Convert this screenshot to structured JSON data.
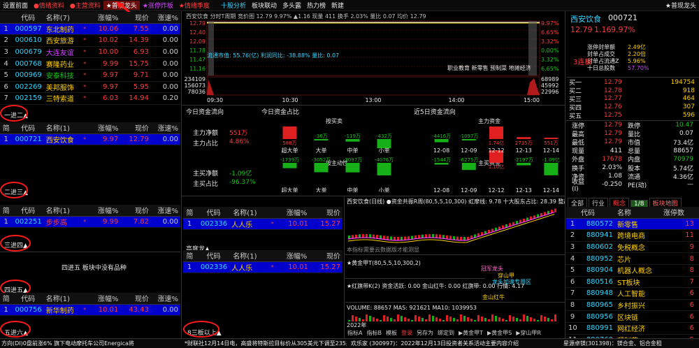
{
  "colors": {
    "bg": "#000000",
    "red": "#ff3b3b",
    "green": "#18c518",
    "cyan": "#33d6ff",
    "yellow": "#ffd200",
    "selected": "#0000cc"
  },
  "topbar": {
    "left": [
      "设置前面",
      "●情绪资料",
      "●主营资料",
      "★普现龙头",
      "★涨停炸板",
      "★情绪季度"
    ],
    "chart_tabs": [
      "十股分析",
      "板块联动",
      "多头露",
      "热力榜",
      "新建"
    ],
    "right": "★普现龙头"
  },
  "left_tables": {
    "top": {
      "headers": [
        "",
        "代码",
        "名称(7)",
        "涨幅%",
        "现价",
        "涨速%"
      ],
      "rows": [
        {
          "idx": "1",
          "code": "000597",
          "name": "东北制药",
          "pct": "10.06",
          "price": "7.55",
          "spd": "0.00",
          "sel": true,
          "name_color": "#ffd200"
        },
        {
          "idx": "2",
          "code": "000610",
          "name": "西安旅游",
          "pct": "10.02",
          "price": "14.39",
          "spd": "0.00",
          "name_color": "#ffd200"
        },
        {
          "idx": "3",
          "code": "000679",
          "name": "大连友谊",
          "pct": "10.00",
          "price": "6.93",
          "spd": "0.00",
          "name_color": "#d040ff"
        },
        {
          "idx": "4",
          "code": "000768",
          "name": "赛隆药业",
          "pct": "9.99",
          "price": "15.75",
          "spd": "0.00",
          "name_color": "#ffd200"
        },
        {
          "idx": "5",
          "code": "000969",
          "name": "安泰科技",
          "pct": "9.97",
          "price": "9.71",
          "spd": "0.00",
          "name_color": "#18c518"
        },
        {
          "idx": "6",
          "code": "002269",
          "name": "美邦服饰",
          "pct": "9.97",
          "price": "5.95",
          "spd": "0.00",
          "name_color": "#ffd200"
        },
        {
          "idx": "7",
          "code": "002159",
          "name": "三特索道",
          "pct": "6.03",
          "price": "14.94",
          "spd": "0.20",
          "name_color": "#ffd200"
        }
      ],
      "footer": "一进二▲"
    },
    "second": {
      "headers": [
        "简",
        "代码",
        "名称(1)",
        "涨幅%",
        "现价",
        "涨速%"
      ],
      "rows": [
        {
          "idx": "1",
          "code": "000721",
          "name": "西安饮食",
          "pct": "9.97",
          "price": "12.79",
          "spd": "0.00",
          "sel": true,
          "name_color": "#ffd200"
        }
      ],
      "footer": "二进三▲"
    },
    "third": {
      "headers": [
        "简",
        "代码",
        "名称(1)",
        "涨幅%",
        "现价",
        "涨速%"
      ],
      "rows": [
        {
          "idx": "1",
          "code": "002251",
          "name": "步步高",
          "pct": "9.99",
          "price": "7.82",
          "spd": "0.00",
          "sel": true,
          "name_color": "#ff3b3b"
        }
      ],
      "footer": "三进四▲"
    },
    "fourth": {
      "empty_msg": "四进五 板块中没有品种",
      "footer": "四进五▲"
    },
    "fifth": {
      "headers": [
        "简",
        "代码",
        "名称(1)",
        "涨幅%",
        "现价",
        "涨速%"
      ],
      "rows": [
        {
          "idx": "1",
          "code": "000756",
          "name": "新华制药",
          "pct": "10.01",
          "price": "43.43",
          "spd": "0.00",
          "sel": true,
          "name_color": "#ffd200"
        }
      ],
      "footer": "五进六▲"
    }
  },
  "mid_tables": {
    "high": {
      "headers": [
        "简",
        "代码",
        "名称(1)",
        "涨幅%",
        "现价"
      ],
      "rows": [
        {
          "idx": "1",
          "code": "002336",
          "name": "人人乐",
          "pct": "10.01",
          "price": "15.27",
          "sel": true,
          "name_color": "#ffd200"
        }
      ],
      "footer": "高度龙▲"
    },
    "eight": {
      "headers": [
        "简",
        "代码",
        "名称(1)",
        "涨幅%",
        "现价"
      ],
      "rows": [
        {
          "idx": "1",
          "code": "002336",
          "name": "人人乐",
          "pct": "10.01",
          "price": "15.27",
          "sel": true,
          "name_color": "#ffd200"
        }
      ],
      "footer": "8三板以上▲"
    }
  },
  "intraday": {
    "header": "西安饮食  分时T周期  竞价图  12.79  9.97%  ▲1.16  现量 411  换手 2.03%  量比 0.07  均价 12.79",
    "y_left": [
      "12.79",
      "12.40",
      "12.09",
      "11.78",
      "11.47",
      "11.16"
    ],
    "y_right": [
      "9.97%",
      "6.65%",
      "3.32%",
      "0.00%",
      "3.32%",
      "6.65%"
    ],
    "vol_left": [
      "234109",
      "156073",
      "78036"
    ],
    "vol_right": [
      "68989",
      "45992",
      "22996"
    ],
    "x_labels": [
      "09:30",
      "10:30",
      "13:00",
      "14:00",
      "15:00"
    ],
    "overlay_info": "流通市值: 55.76(亿)  利润同比: -38.88%  量比: 0.07",
    "tags": "职业教育  新零售  预制菜  地摊经济"
  },
  "fund": {
    "title_today": "今日资金流向",
    "title_share": "今日资金占比",
    "title_5day": "近5日资金流向",
    "main_net_label": "主力净额",
    "main_net": "551万",
    "main_ratio_label": "主力占比",
    "main_ratio": "4.86%",
    "buy_net_label": "主买净额",
    "buy_net": "-1.09亿",
    "buy_ratio_label": "主买占比",
    "buy_ratio": "-96.37%",
    "buysell_title": "按买卖",
    "active_title": "按主动性",
    "cats": [
      "超大单",
      "大单",
      "中单",
      "小单"
    ],
    "share_top_vals": [
      "588万",
      "-36万",
      "-119万",
      "-432万"
    ],
    "share_bot_vals": [
      "-1739万",
      "-3052万",
      "-3097万",
      "-4076万"
    ],
    "main_fund_title": "主力资金",
    "main_buy_title": "主买资金",
    "dates": [
      "12-08",
      "12-09",
      "12-12",
      "12-13",
      "12-14"
    ],
    "five_top_vals": [
      "-4416万",
      "-1097万",
      "1.74亿",
      "2735万",
      "551万"
    ],
    "five_bot_vals": [
      "-1544万",
      "-6275万",
      "1.10亿",
      "-2197万",
      "-1.09亿"
    ]
  },
  "kline": {
    "header": "西安饮食(日线) ●资金共振R周(80,5,5,10,300)  虹摩线: 9.78  十大股东占比: 28.39  整超",
    "note": "本指标需要云数据版才能测显",
    "ind1": "★黄金甲T(80,5,5,10,300,2)",
    "ind2": "★红旗带K(2)  资金活跃: 0.00  金山红牛: 0.00  红旗带: 0.00  行情: 4.17",
    "ind3": "VOLUME: 88657  MAS: 921621  MA10: 1039953",
    "marker1": "冠军龙头",
    "marker2": "穿山甲",
    "marker3": "龙头加速专用区",
    "marker4": "金山红牛",
    "year_label": "2022年",
    "bottom_tabs": [
      "指标A",
      "指标B",
      "模板",
      "登录",
      "另存为",
      "绑定到",
      "▶黄金甲T",
      "▶黄金甲S",
      "▶穿山甲R"
    ]
  },
  "quote": {
    "name": "西安饮食",
    "code": "000721",
    "price": "12.79",
    "chg": "1.16",
    "pct": "9.97%",
    "sub_rows": [
      {
        "k": "涨停封单额",
        "v": "2.49亿"
      },
      {
        "k": "封单占成交",
        "v": "2.20倍"
      },
      {
        "k": "封单占流通Z",
        "v": "5.96%"
      },
      {
        "k": "十日总股数",
        "v": "57.70%"
      }
    ],
    "board_tag": "3连板",
    "asks": [
      {
        "k": "买一",
        "p": "12.79",
        "v": "194754"
      },
      {
        "k": "买二",
        "p": "12.78",
        "v": "918"
      },
      {
        "k": "买三",
        "p": "12.77",
        "v": "464"
      },
      {
        "k": "买四",
        "p": "12.76",
        "v": "307"
      },
      {
        "k": "买五",
        "p": "12.75",
        "v": "596"
      }
    ],
    "stats": [
      {
        "k": "涨停",
        "v": "12.79",
        "k2": "跌停",
        "v2": "10.47"
      },
      {
        "k": "最高",
        "v": "12.79",
        "k2": "量比",
        "v2": "0.07"
      },
      {
        "k": "最低",
        "v": "12.79",
        "k2": "市值",
        "v2": "73.4亿"
      },
      {
        "k": "现量",
        "v": "411",
        "k2": "总量",
        "v2": "88657"
      },
      {
        "k": "外盘",
        "v": "17678",
        "k2": "内盘",
        "v2": "70979"
      },
      {
        "k": "换手",
        "v": "2.03%",
        "k2": "股本",
        "v2": "5.74亿"
      },
      {
        "k": "净资",
        "v": "1.08",
        "k2": "流通",
        "v2": "4.36亿"
      },
      {
        "k": "收益(Ⅰ)",
        "v": "-0.250",
        "k2": "PE(动)",
        "v2": "—"
      }
    ]
  },
  "sector": {
    "tabs": [
      "全部",
      "行业",
      "概念",
      "1/8",
      "板块地图"
    ],
    "headers": [
      "",
      "代码",
      "名称",
      "涨停数"
    ],
    "rows": [
      {
        "idx": "1",
        "code": "880572",
        "name": "新零售",
        "cnt": "13",
        "sel": true
      },
      {
        "idx": "2",
        "code": "880941",
        "name": "跨境电商",
        "cnt": "11"
      },
      {
        "idx": "3",
        "code": "880602",
        "name": "免税概念",
        "cnt": "9"
      },
      {
        "idx": "4",
        "code": "880952",
        "name": "芯片",
        "cnt": "8"
      },
      {
        "idx": "5",
        "code": "880904",
        "name": "机器人概念",
        "cnt": "8"
      },
      {
        "idx": "6",
        "code": "880516",
        "name": "ST板块",
        "cnt": "7"
      },
      {
        "idx": "7",
        "code": "880948",
        "name": "人工智能",
        "cnt": "6"
      },
      {
        "idx": "8",
        "code": "880965",
        "name": "乡村振兴",
        "cnt": "6"
      },
      {
        "idx": "9",
        "code": "880956",
        "name": "区块链",
        "cnt": "6"
      },
      {
        "idx": "10",
        "code": "880991",
        "name": "网红经济",
        "cnt": "6"
      },
      {
        "idx": "11",
        "code": "880760",
        "name": "预制菜",
        "cnt": "5"
      }
    ]
  },
  "status": {
    "left": "方向(DI)0盘前涨6% 旗下电动摩托车公司Energica将",
    "mid": "*财联社12月14日电，高盛将特斯拉目标价从305美元下调至235美元。",
    "news1": "欢乐家 (300997)：2022年12月13日投资者关系活动主要内容介绍",
    "news2": "星源卓镁(301398)：镁合金、铝合金租"
  }
}
